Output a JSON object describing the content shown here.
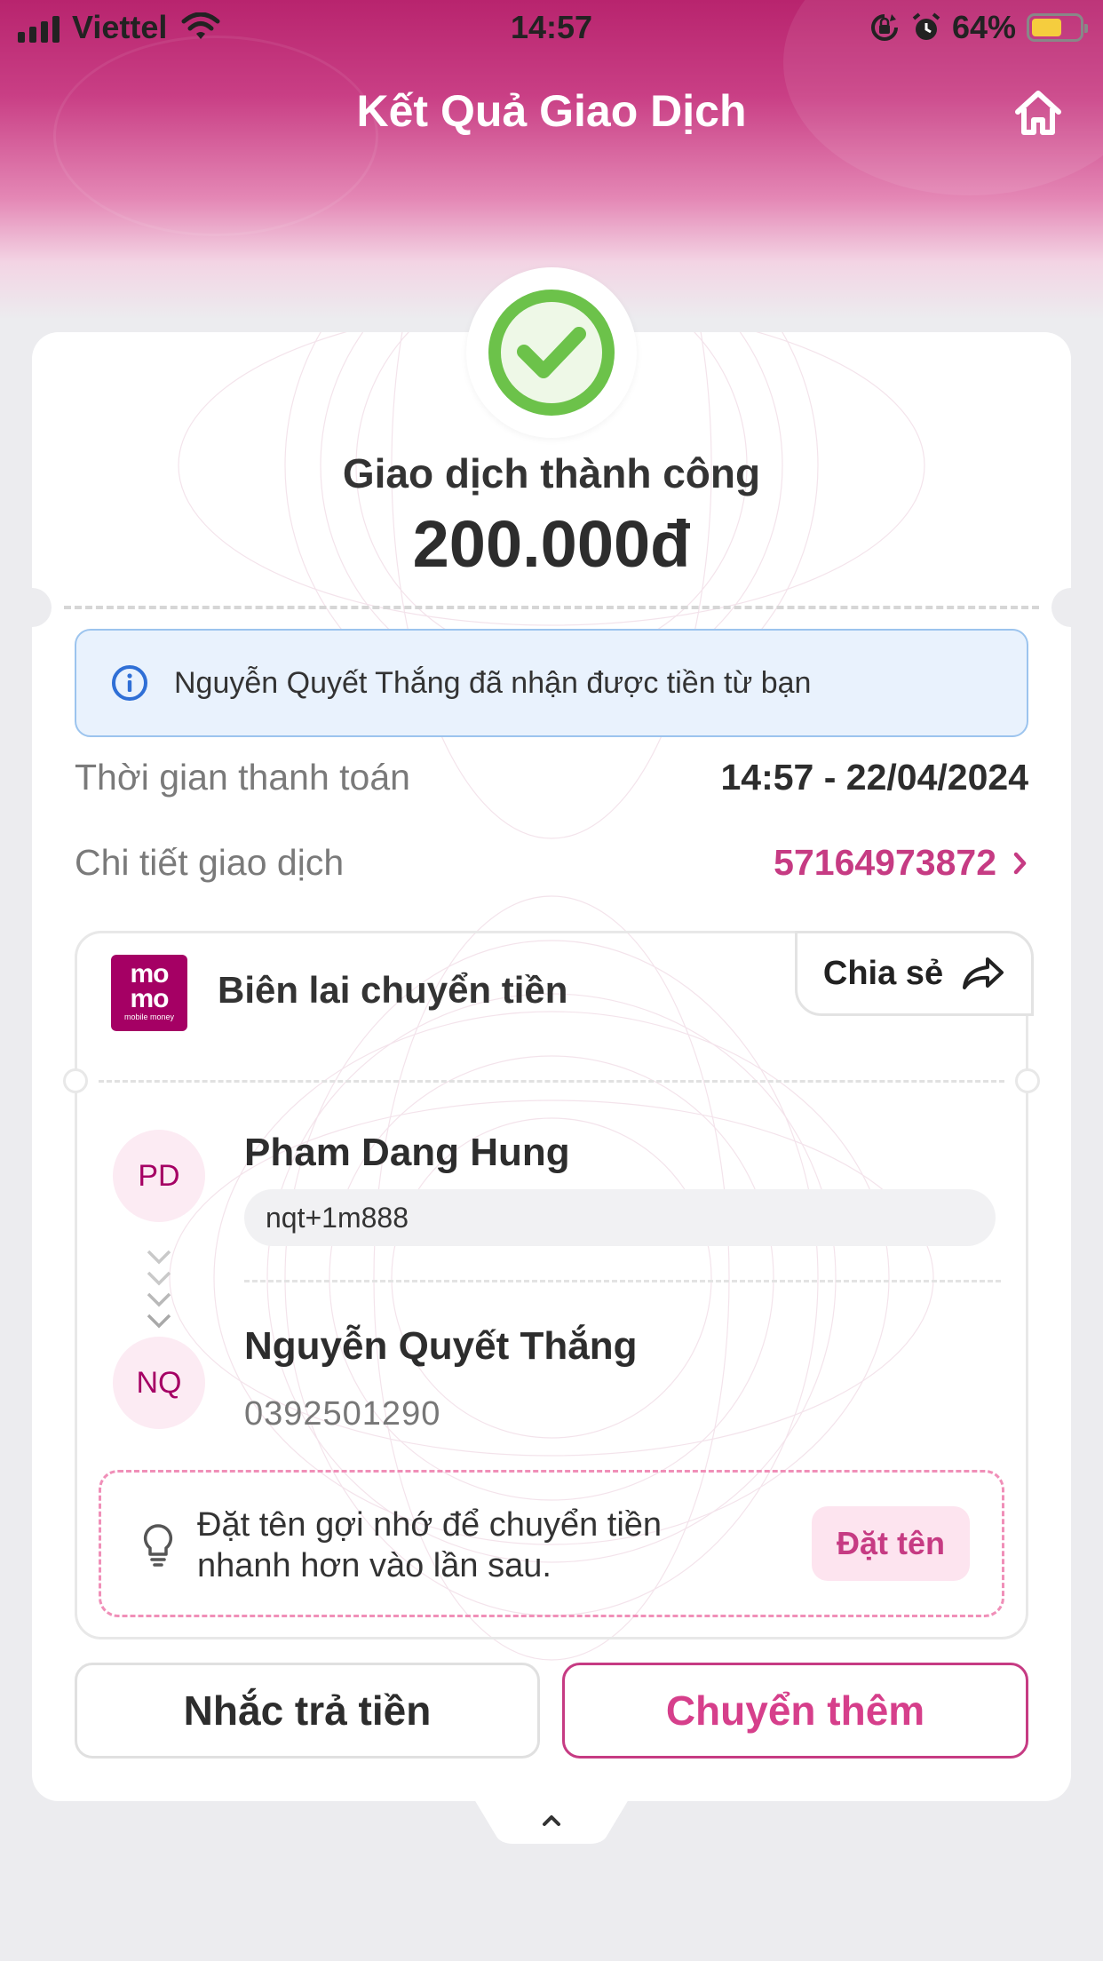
{
  "status_bar": {
    "carrier": "Viettel",
    "time": "14:57",
    "battery_percent": "64%",
    "battery_level": 0.64,
    "icons": [
      "signal-icon",
      "wifi-icon",
      "rotation-lock-icon",
      "alarm-icon",
      "battery-icon"
    ]
  },
  "header": {
    "title": "Kết Quả Giao Dịch",
    "home_icon": "home-icon"
  },
  "result": {
    "status": "Giao dịch thành công",
    "amount": "200.000đ",
    "icon": "check-circle-icon",
    "accent_color": "#6cc24a"
  },
  "info_banner": {
    "icon": "info-icon",
    "text": "Nguyễn Quyết Thắng đã nhận được tiền từ bạn"
  },
  "details": {
    "time_label": "Thời gian thanh toán",
    "time_value": "14:57 - 22/04/2024",
    "txn_label": "Chi tiết giao dịch",
    "txn_value": "57164973872"
  },
  "receipt": {
    "logo_line1": "mo",
    "logo_line2": "mo",
    "logo_sub": "mobile money",
    "title": "Biên lai chuyển tiền",
    "share_label": "Chia sẻ",
    "sender": {
      "initials": "PD",
      "name": "Pham Dang Hung",
      "note": "nqt+1m888"
    },
    "receiver": {
      "initials": "NQ",
      "name": "Nguyễn Quyết Thắng",
      "phone": "0392501290"
    },
    "suggestion": {
      "line1": "Đặt tên gợi nhớ để chuyển tiền",
      "line2": "nhanh hơn vào lần sau.",
      "button": "Đặt tên"
    }
  },
  "actions": {
    "remind_label": "Nhắc trả tiền",
    "transfer_more_label": "Chuyển thêm"
  },
  "colors": {
    "brand": "#a50064",
    "accent_pink": "#c63b83",
    "success": "#6cc24a",
    "info_bg": "#e9f2fd"
  }
}
